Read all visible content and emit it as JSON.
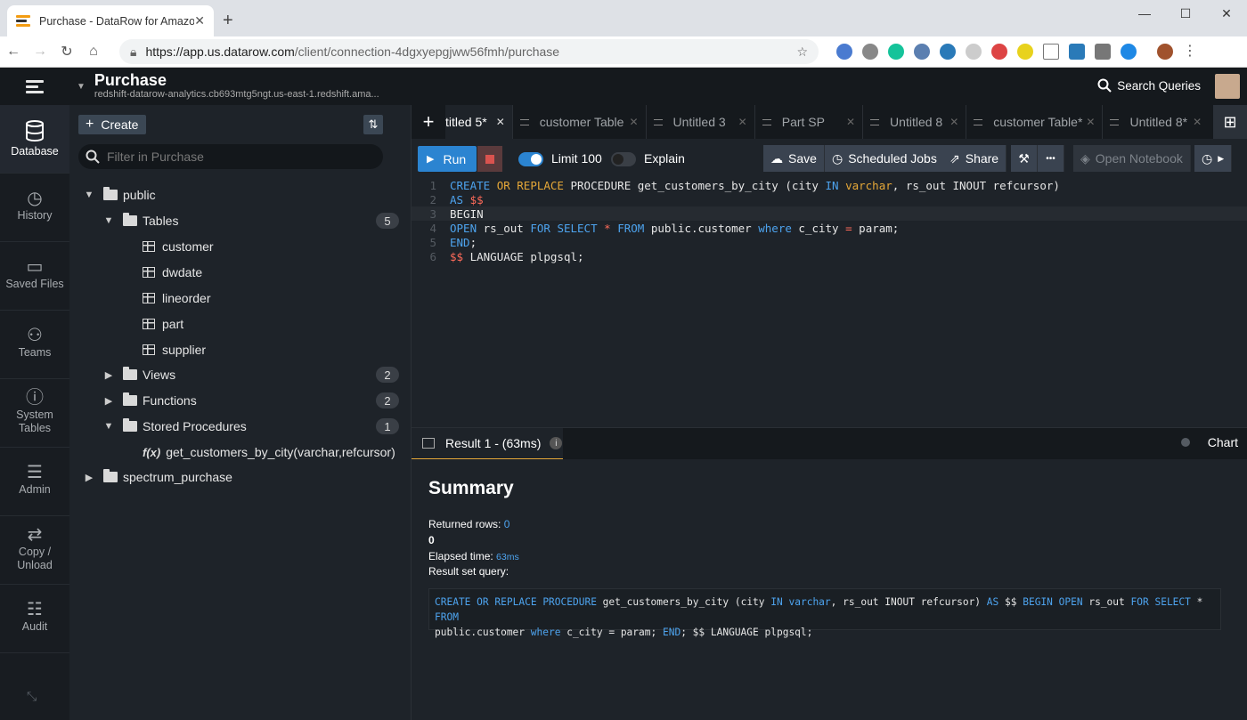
{
  "browser": {
    "tab_title": "Purchase - DataRow for Amazon",
    "tab_close": "✕",
    "new_tab": "+",
    "url_host": "https://app.us.datarow.com",
    "url_path": "/client/connection-4dgxyepgjww56fmh/purchase",
    "window_controls": [
      "—",
      "☐",
      "✕"
    ]
  },
  "header": {
    "connection_title": "Purchase",
    "connection_subtitle": "redshift-datarow-analytics.cb693mtg5ngt.us-east-1.redshift.ama...",
    "search_queries": "Search Queries"
  },
  "rail": [
    {
      "label": "Database",
      "icon": "database-icon",
      "active": true
    },
    {
      "label": "History",
      "icon": "history-icon"
    },
    {
      "label": "Saved Files",
      "icon": "folder-icon"
    },
    {
      "label": "Teams",
      "icon": "team-icon"
    },
    {
      "label": "System Tables",
      "icon": "alert-icon"
    },
    {
      "label": "Admin",
      "icon": "sliders-icon"
    },
    {
      "label": "Copy / Unload",
      "icon": "transfer-icon"
    },
    {
      "label": "Audit",
      "icon": "checklist-icon"
    }
  ],
  "sidebar": {
    "create_label": "Create",
    "filter_placeholder": "Filter in Purchase",
    "tree": {
      "public": "public",
      "tables": {
        "label": "Tables",
        "count": "5",
        "items": [
          "customer",
          "dwdate",
          "lineorder",
          "part",
          "supplier"
        ]
      },
      "views": {
        "label": "Views",
        "count": "2"
      },
      "functions": {
        "label": "Functions",
        "count": "2"
      },
      "procedures": {
        "label": "Stored Procedures",
        "count": "1",
        "items": [
          "get_customers_by_city(varchar,refcursor)"
        ]
      },
      "spectrum": "spectrum_purchase"
    }
  },
  "editor_tabs": [
    {
      "label": "titled 5*",
      "active": true
    },
    {
      "label": "customer Table"
    },
    {
      "label": "Untitled 3"
    },
    {
      "label": "Part SP"
    },
    {
      "label": "Untitled 8"
    },
    {
      "label": "customer Table*"
    },
    {
      "label": "Untitled 8*"
    }
  ],
  "toolbar": {
    "run": "Run",
    "limit": "Limit 100",
    "explain": "Explain",
    "save": "Save",
    "scheduled_jobs": "Scheduled Jobs",
    "share": "Share",
    "more": "•••",
    "open_notebook": "Open Notebook"
  },
  "code": {
    "line_numbers": [
      "1",
      "2",
      "3",
      "4",
      "5",
      "6"
    ]
  },
  "results": {
    "tab_label": "Result 1 - (63ms)",
    "chart_label": "Chart",
    "summary_title": "Summary",
    "returned_rows_label": "Returned rows:",
    "returned_rows_value": "0",
    "rows_line2": "0",
    "elapsed_label": "Elapsed time:",
    "elapsed_value": "63ms",
    "result_query_label": "Result set query:"
  }
}
